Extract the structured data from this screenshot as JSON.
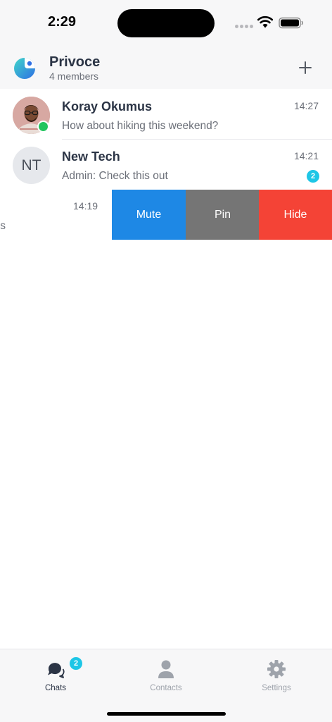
{
  "status_bar": {
    "time": "2:29"
  },
  "header": {
    "group_name": "Privoce",
    "members": "4 members",
    "add_icon": "plus-icon"
  },
  "chats": [
    {
      "name": "Koray Okumus",
      "time": "14:27",
      "message": "How about hiking this weekend?",
      "online": true,
      "avatar": "photo"
    },
    {
      "name": "New Tech",
      "initials": "NT",
      "time": "14:21",
      "message": "Admin: Check this out",
      "unread": "2"
    }
  ],
  "swiped_chat": {
    "time": "14:19",
    "message_tail": "s",
    "actions": {
      "mute": "Mute",
      "pin": "Pin",
      "hide": "Hide"
    }
  },
  "tabs": [
    {
      "label": "Chats",
      "icon": "chat-bubbles-icon",
      "badge": "2",
      "active": true
    },
    {
      "label": "Contacts",
      "icon": "person-icon",
      "active": false
    },
    {
      "label": "Settings",
      "icon": "gear-icon",
      "active": false
    }
  ],
  "colors": {
    "accent": "#1ec6e6",
    "mute": "#1e88e5",
    "pin": "#757575",
    "hide": "#f44336",
    "online": "#22c55e"
  }
}
